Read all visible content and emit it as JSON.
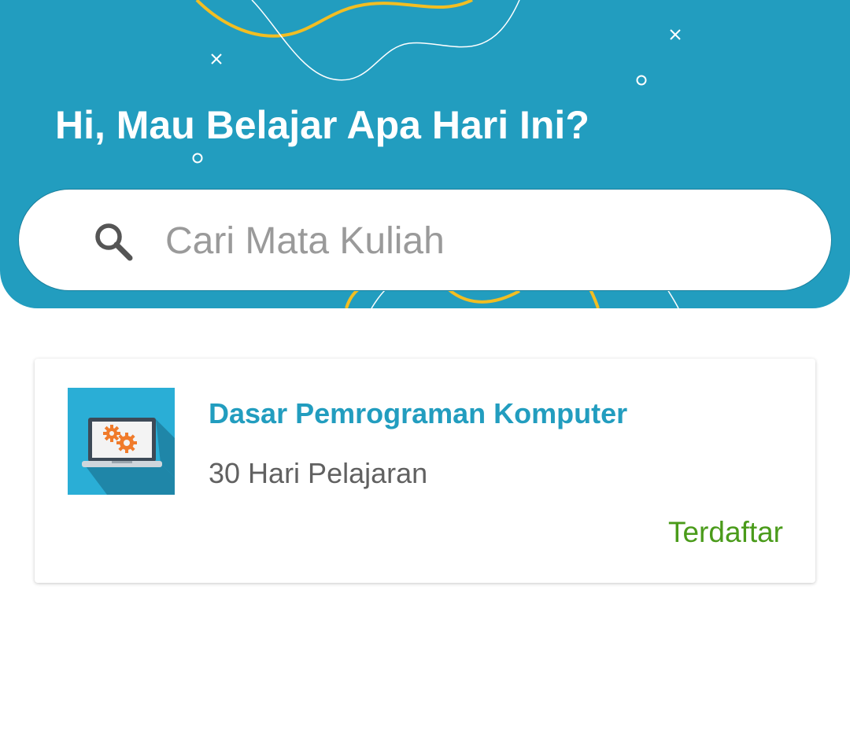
{
  "header": {
    "greeting": "Hi, Mau Belajar Apa Hari Ini?",
    "background_color": "#229dbf"
  },
  "search": {
    "placeholder": "Cari Mata Kuliah",
    "value": "",
    "icon": "search-icon"
  },
  "courses": [
    {
      "title": "Dasar Pemrograman Komputer",
      "duration": "30 Hari Pelajaran",
      "status": "Terdaftar",
      "thumbnail_icon": "laptop-gears-icon",
      "title_color": "#229dbf",
      "status_color": "#4a9b1a"
    }
  ]
}
